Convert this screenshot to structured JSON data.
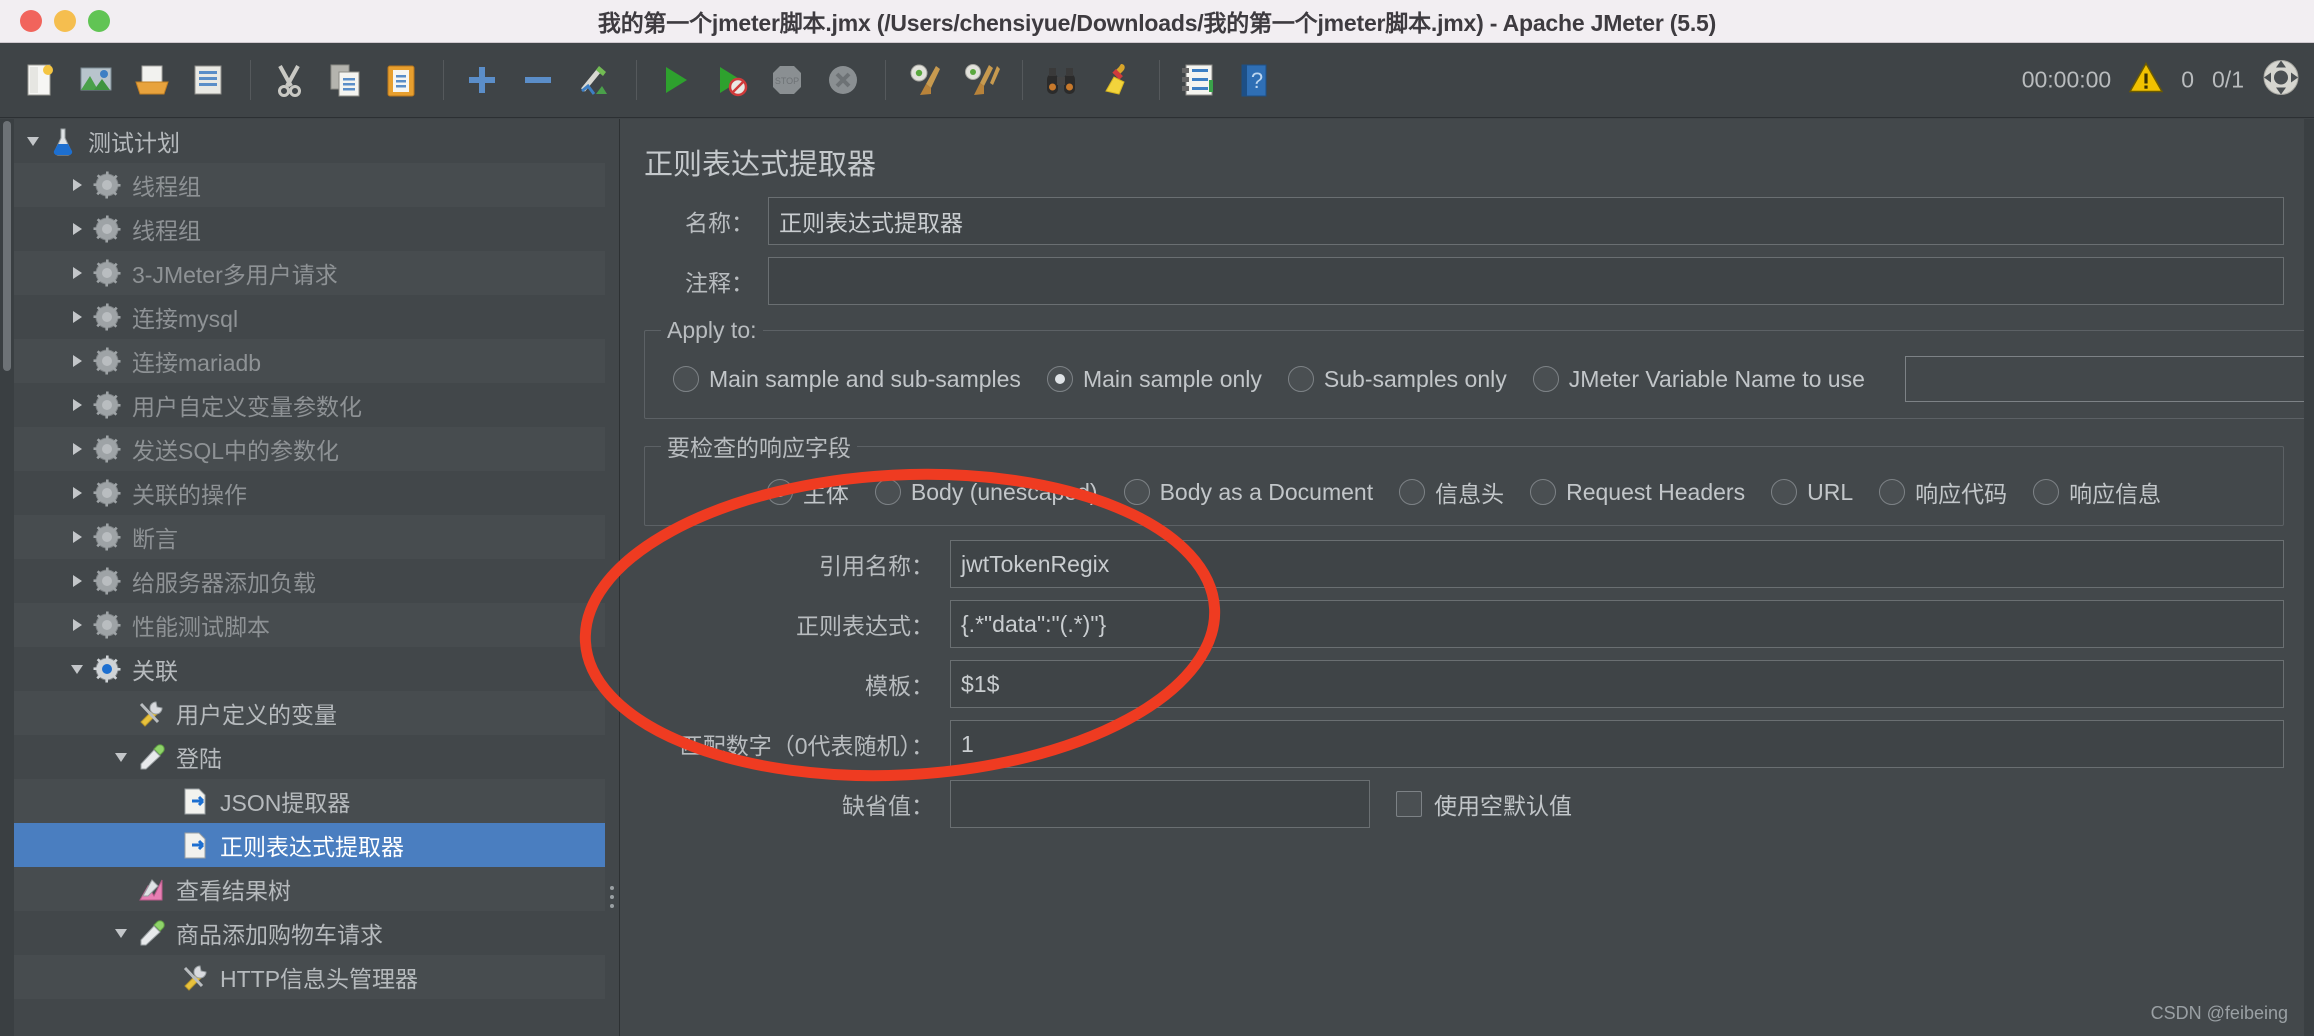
{
  "window": {
    "title": "我的第一个jmeter脚本.jmx (/Users/chensiyue/Downloads/我的第一个jmeter脚本.jmx) - Apache JMeter (5.5)",
    "traffic_lights": [
      "close-red",
      "minimize-yellow",
      "maximize-green"
    ]
  },
  "toolbar": {
    "buttons": [
      {
        "name": "new-test-plan",
        "icon": "new-document-icon",
        "tooltip": "New"
      },
      {
        "name": "open-templates",
        "icon": "templates-icon",
        "tooltip": "Templates"
      },
      {
        "name": "open-file",
        "icon": "open-folder-icon",
        "tooltip": "Open"
      },
      {
        "name": "save-test-plan",
        "icon": "save-icon",
        "tooltip": "Save"
      },
      {
        "name": "cut",
        "icon": "scissors-icon",
        "tooltip": "Cut"
      },
      {
        "name": "copy",
        "icon": "copy-icon",
        "tooltip": "Copy"
      },
      {
        "name": "paste",
        "icon": "clipboard-paste-icon",
        "tooltip": "Paste"
      },
      {
        "name": "expand-all",
        "icon": "plus-icon",
        "tooltip": "Expand All"
      },
      {
        "name": "collapse-all",
        "icon": "minus-icon",
        "tooltip": "Collapse All"
      },
      {
        "name": "toggle-enabled",
        "icon": "pencil-toggle-icon",
        "tooltip": "Toggle"
      },
      {
        "name": "start",
        "icon": "play-green-icon",
        "tooltip": "Start"
      },
      {
        "name": "start-no-timers",
        "icon": "play-no-timers-icon",
        "tooltip": "Start no pauses"
      },
      {
        "name": "stop",
        "icon": "stop-sign-icon",
        "tooltip": "Stop"
      },
      {
        "name": "shutdown",
        "icon": "shutdown-x-icon",
        "tooltip": "Shutdown"
      },
      {
        "name": "clear",
        "icon": "gear-broom-icon",
        "tooltip": "Clear"
      },
      {
        "name": "clear-all",
        "icon": "gear-broom-double-icon",
        "tooltip": "Clear All"
      },
      {
        "name": "search",
        "icon": "binoculars-icon",
        "tooltip": "Search"
      },
      {
        "name": "reset-search",
        "icon": "broom-yellow-icon",
        "tooltip": "Reset Search"
      },
      {
        "name": "function-helper",
        "icon": "list-notebook-icon",
        "tooltip": "Function Helper Dialog"
      },
      {
        "name": "help",
        "icon": "help-book-icon",
        "tooltip": "Help"
      }
    ],
    "timer": "00:00:00",
    "warning_icon": "warning-triangle-icon",
    "warning_count": "0",
    "threads_status": "0/1",
    "status_icon": "remote-engine-icon"
  },
  "tree": {
    "items": [
      {
        "label": "测试计划",
        "icon": "flask-icon",
        "depth": 0,
        "twisty": "open",
        "state": "normal"
      },
      {
        "label": "线程组",
        "icon": "gear-disabled-icon",
        "depth": 1,
        "twisty": "closed",
        "state": "disabled"
      },
      {
        "label": "线程组",
        "icon": "gear-disabled-icon",
        "depth": 1,
        "twisty": "closed",
        "state": "disabled"
      },
      {
        "label": "3-JMeter多用户请求",
        "icon": "gear-disabled-icon",
        "depth": 1,
        "twisty": "closed",
        "state": "disabled"
      },
      {
        "label": "连接mysql",
        "icon": "gear-disabled-icon",
        "depth": 1,
        "twisty": "closed",
        "state": "disabled"
      },
      {
        "label": "连接mariadb",
        "icon": "gear-disabled-icon",
        "depth": 1,
        "twisty": "closed",
        "state": "disabled"
      },
      {
        "label": "用户自定义变量参数化",
        "icon": "gear-disabled-icon",
        "depth": 1,
        "twisty": "closed",
        "state": "disabled"
      },
      {
        "label": "发送SQL中的参数化",
        "icon": "gear-disabled-icon",
        "depth": 1,
        "twisty": "closed",
        "state": "disabled"
      },
      {
        "label": "关联的操作",
        "icon": "gear-disabled-icon",
        "depth": 1,
        "twisty": "closed",
        "state": "disabled"
      },
      {
        "label": "断言",
        "icon": "gear-disabled-icon",
        "depth": 1,
        "twisty": "closed",
        "state": "disabled"
      },
      {
        "label": "给服务器添加负载",
        "icon": "gear-disabled-icon",
        "depth": 1,
        "twisty": "closed",
        "state": "disabled"
      },
      {
        "label": "性能测试脚本",
        "icon": "gear-disabled-icon",
        "depth": 1,
        "twisty": "closed",
        "state": "disabled"
      },
      {
        "label": "关联",
        "icon": "gear-active-icon",
        "depth": 1,
        "twisty": "open",
        "state": "normal"
      },
      {
        "label": "用户定义的变量",
        "icon": "tools-icon",
        "depth": 2,
        "twisty": "none",
        "state": "normal"
      },
      {
        "label": "登陆",
        "icon": "pipette-icon",
        "depth": 2,
        "twisty": "open",
        "state": "normal"
      },
      {
        "label": "JSON提取器",
        "icon": "post-processor-icon",
        "depth": 3,
        "twisty": "none",
        "state": "normal"
      },
      {
        "label": "正则表达式提取器",
        "icon": "post-processor-icon",
        "depth": 3,
        "twisty": "none",
        "state": "selected"
      },
      {
        "label": "查看结果树",
        "icon": "results-tree-icon",
        "depth": 2,
        "twisty": "none",
        "state": "normal"
      },
      {
        "label": "商品添加购物车请求",
        "icon": "pipette-icon",
        "depth": 2,
        "twisty": "open",
        "state": "normal"
      },
      {
        "label": "HTTP信息头管理器",
        "icon": "tools-icon",
        "depth": 3,
        "twisty": "none",
        "state": "normal"
      }
    ]
  },
  "panel": {
    "title": "正则表达式提取器",
    "name_label": "名称：",
    "name_value": "正则表达式提取器",
    "comment_label": "注释：",
    "comment_value": "",
    "apply_to": {
      "legend": "Apply to:",
      "options": [
        {
          "label": "Main sample and sub-samples",
          "selected": false
        },
        {
          "label": "Main sample only",
          "selected": true
        },
        {
          "label": "Sub-samples only",
          "selected": false
        },
        {
          "label": "JMeter Variable Name to use",
          "selected": false
        }
      ],
      "variable_value": ""
    },
    "field_to_check": {
      "legend": "要检查的响应字段",
      "options": [
        {
          "label": "主体",
          "selected": true
        },
        {
          "label": "Body (unescaped)",
          "selected": false
        },
        {
          "label": "Body as a Document",
          "selected": false
        },
        {
          "label": "信息头",
          "selected": false
        },
        {
          "label": "Request Headers",
          "selected": false
        },
        {
          "label": "URL",
          "selected": false
        },
        {
          "label": "响应代码",
          "selected": false
        },
        {
          "label": "响应信息",
          "selected": false
        }
      ]
    },
    "fields": [
      {
        "label": "引用名称：",
        "value": "jwtTokenRegix",
        "name": "reference-name"
      },
      {
        "label": "正则表达式：",
        "value": "{.*\"data\":\"(.*)\"}",
        "name": "regular-expression"
      },
      {
        "label": "模板：",
        "value": "$1$",
        "name": "template"
      },
      {
        "label": "匹配数字（0代表随机）：",
        "value": "1",
        "name": "match-number"
      },
      {
        "label": "缺省值：",
        "value": "",
        "name": "default-value"
      }
    ],
    "use_empty_default": {
      "label": "使用空默认值",
      "checked": false
    }
  },
  "watermark": "CSDN @feibeing",
  "colors": {
    "selection": "#4a7ec0",
    "annotation": "#ef3b21",
    "panel_bg": "#43484b",
    "toolbar_bg": "#3f4447",
    "titlebar_bg": "#f2eef2"
  }
}
